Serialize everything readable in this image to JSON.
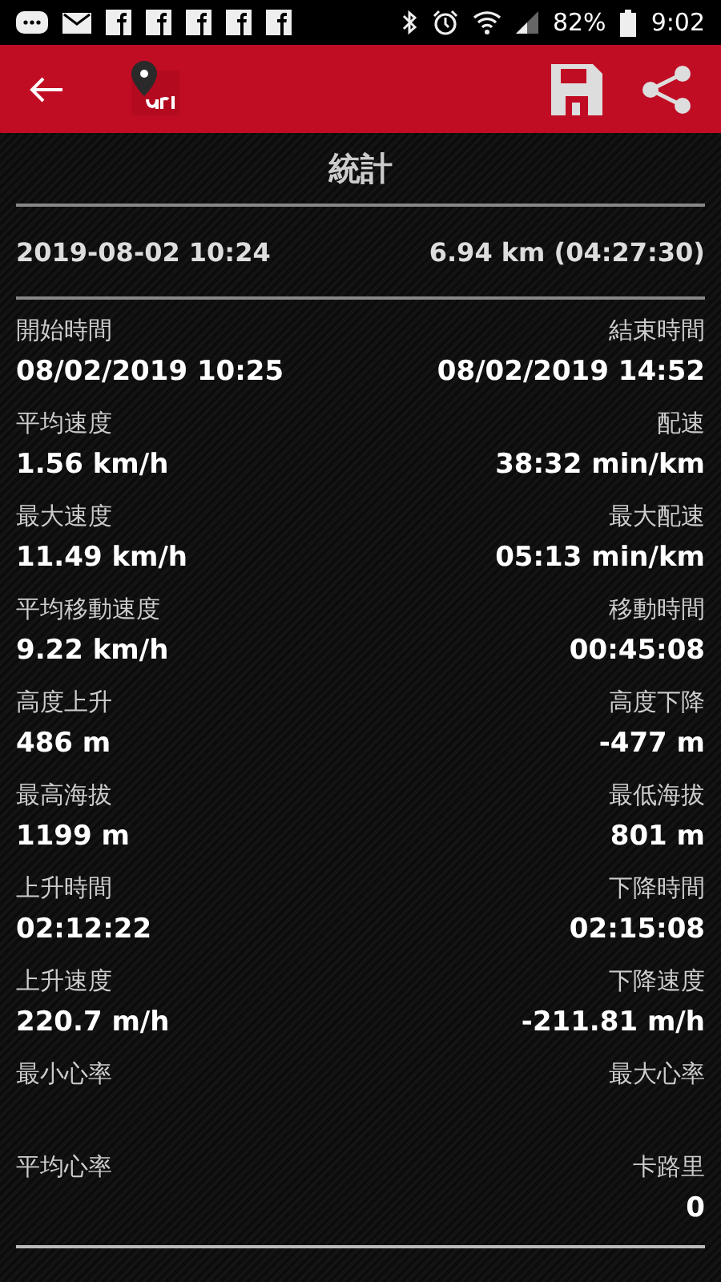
{
  "status_bar": {
    "battery": "82%",
    "time": "9:02"
  },
  "title": "統計",
  "summary": {
    "start": "2019-08-02 10:24",
    "distance": "6.94 km (04:27:30)"
  },
  "stats": [
    {
      "left": {
        "label": "開始時間",
        "value": "08/02/2019 10:25"
      },
      "right": {
        "label": "結束時間",
        "value": "08/02/2019 14:52"
      }
    },
    {
      "left": {
        "label": "平均速度",
        "value": "1.56 km/h"
      },
      "right": {
        "label": "配速",
        "value": "38:32 min/km"
      }
    },
    {
      "left": {
        "label": "最大速度",
        "value": "11.49 km/h"
      },
      "right": {
        "label": "最大配速",
        "value": "05:13 min/km"
      }
    },
    {
      "left": {
        "label": "平均移動速度",
        "value": "9.22 km/h"
      },
      "right": {
        "label": "移動時間",
        "value": "00:45:08"
      }
    },
    {
      "left": {
        "label": "高度上升",
        "value": "486 m"
      },
      "right": {
        "label": "高度下降",
        "value": "-477 m"
      }
    },
    {
      "left": {
        "label": "最高海拔",
        "value": "1199 m"
      },
      "right": {
        "label": "最低海拔",
        "value": "801 m"
      }
    },
    {
      "left": {
        "label": "上升時間",
        "value": "02:12:22"
      },
      "right": {
        "label": "下降時間",
        "value": "02:15:08"
      }
    },
    {
      "left": {
        "label": "上升速度",
        "value": "220.7 m/h"
      },
      "right": {
        "label": "下降速度",
        "value": "-211.81 m/h"
      }
    },
    {
      "left": {
        "label": "最小心率"
      },
      "right": {
        "label": "最大心率"
      }
    },
    {
      "left": {
        "label": "平均心率"
      },
      "right": {
        "label": "卡路里",
        "value": "0"
      }
    }
  ]
}
